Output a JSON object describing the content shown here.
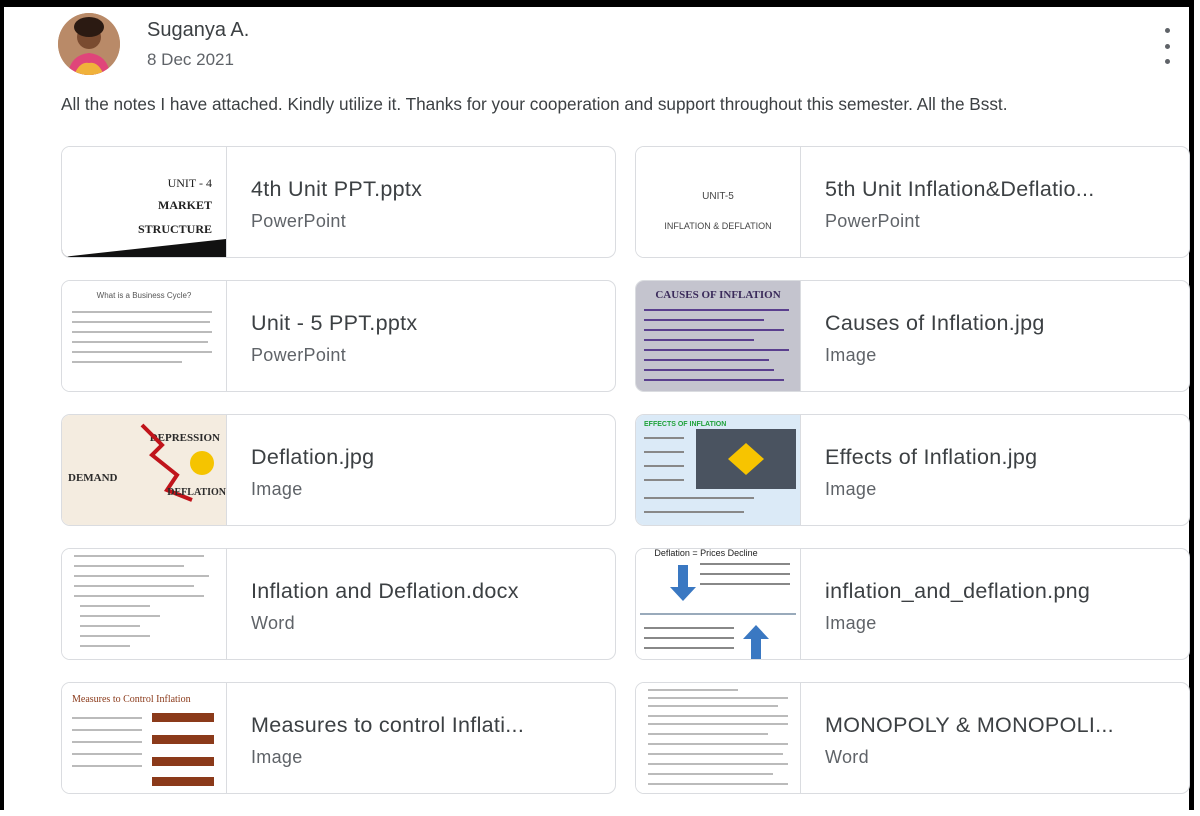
{
  "post": {
    "author": "Suganya A.",
    "date": "8 Dec 2021",
    "text": "All the notes I have attached. Kindly utilize it. Thanks for your cooperation and support throughout this semester. All the Bsst.",
    "more_icon": "more-vert-icon"
  },
  "attachments": [
    {
      "title": "4th Unit PPT.pptx",
      "type": "PowerPoint",
      "thumb_lines": [
        "UNIT - 4",
        "MARKET",
        "STRUCTURE"
      ]
    },
    {
      "title": "5th Unit Inflation&Deflatio...",
      "type": "PowerPoint",
      "thumb_lines": [
        "UNIT-5",
        "INFLATION & DEFLATION"
      ]
    },
    {
      "title": "Unit - 5 PPT.pptx",
      "type": "PowerPoint",
      "thumb_lines": [
        "What is a Business Cycle?"
      ]
    },
    {
      "title": "Causes of Inflation.jpg",
      "type": "Image",
      "thumb_lines": [
        "CAUSES OF INFLATION"
      ]
    },
    {
      "title": "Deflation.jpg",
      "type": "Image",
      "thumb_lines": [
        "DEPRESSION",
        "DEMAND",
        "DEFLATION"
      ]
    },
    {
      "title": "Effects of Inflation.jpg",
      "type": "Image",
      "thumb_lines": [
        "EFFECTS OF INFLATION"
      ]
    },
    {
      "title": "Inflation and Deflation.docx",
      "type": "Word",
      "thumb_lines": []
    },
    {
      "title": "inflation_and_deflation.png",
      "type": "Image",
      "thumb_lines": [
        "Deflation = Prices Decline"
      ]
    },
    {
      "title": "Measures to control Inflati...",
      "type": "Image",
      "thumb_lines": [
        "Measures to Control Inflation"
      ]
    },
    {
      "title": "MONOPOLY & MONOPOLI...",
      "type": "Word",
      "thumb_lines": []
    }
  ]
}
